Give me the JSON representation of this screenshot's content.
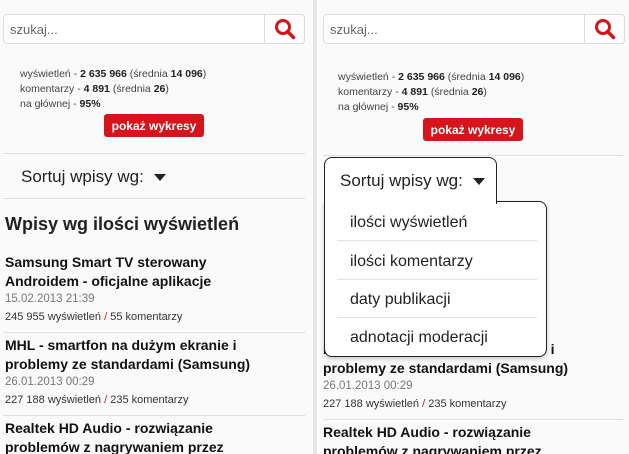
{
  "search": {
    "placeholder": "szukaj..."
  },
  "stats": {
    "views_label": "wyświetleń",
    "views_value": "2 635 966",
    "views_avg_label": "średnia",
    "views_avg_value": "14 096",
    "comments_label": "komentarzy",
    "comments_value": "4 891",
    "comments_avg_label": "średnia",
    "comments_avg_value": "26",
    "home_label": "na głównej",
    "home_value": "95%"
  },
  "charts_button": "pokaż wykresy",
  "sort": {
    "label": "Sortuj wpisy wg:"
  },
  "heading": "Wpisy wg ilości wyświetleń",
  "sort_options": [
    "ilości wyświetleń",
    "ilości komentarzy",
    "daty publikacji",
    "adnotacji moderacji"
  ],
  "posts": [
    {
      "title_line1": "Samsung Smart TV sterowany",
      "title_line2": "Androidem - oficjalne aplikacje",
      "date": "15.02.2013 21:39",
      "views": "245 955 wyświetleń",
      "comments": "55 komentarzy"
    },
    {
      "title_line1": "MHL - smartfon na dużym ekranie i",
      "title_line2": "problemy ze standardami (Samsung)",
      "date": "26.01.2013 00:29",
      "views": "227 188 wyświetleń",
      "comments": "235 komentarzy"
    },
    {
      "title_line1": "Realtek HD Audio - rozwiązanie",
      "title_line2": "problemów z nagrywaniem przez",
      "date": "",
      "views": "",
      "comments": ""
    }
  ],
  "colors": {
    "accent": "#d6141b",
    "background": "#fafafa"
  },
  "icons": {
    "search": "search-icon",
    "caret": "caret-down-icon"
  }
}
